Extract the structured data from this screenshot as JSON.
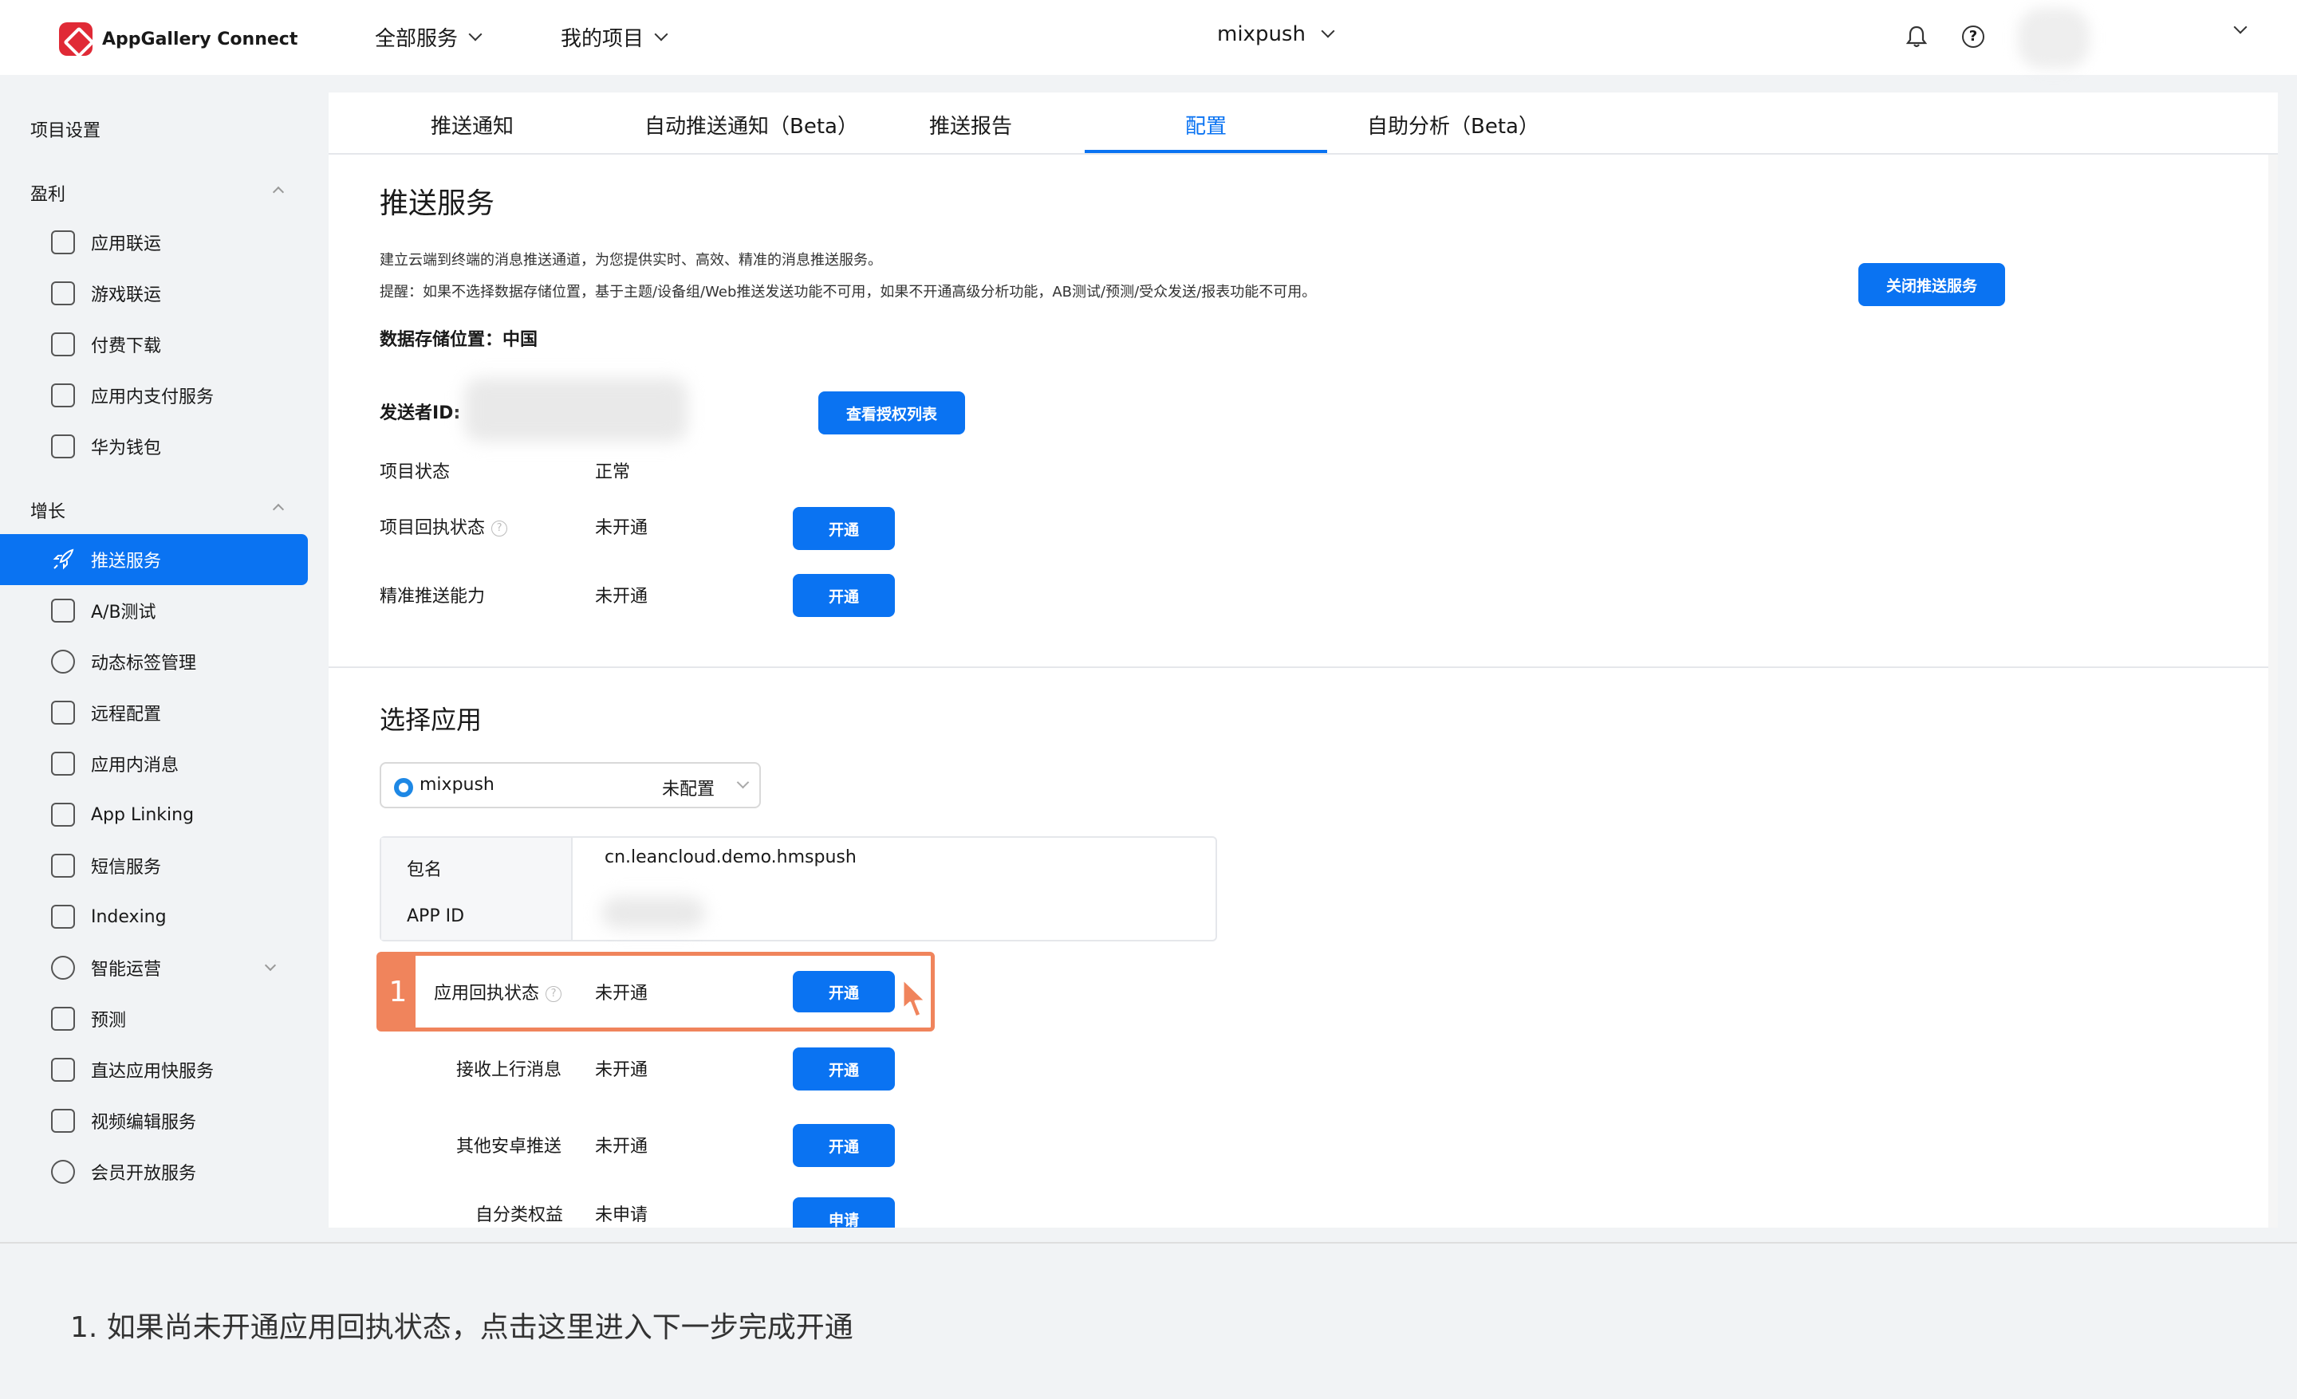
{
  "header": {
    "app_name": "AppGallery Connect",
    "menu_all_services": "全部服务",
    "menu_my_projects": "我的项目",
    "project_selector": "mixpush",
    "help_symbol": "?"
  },
  "sidebar": {
    "project_settings": "项目设置",
    "group_monetize": "盈利",
    "monetize_items": [
      {
        "label": "应用联运",
        "icon": "app-operation-icon"
      },
      {
        "label": "游戏联运",
        "icon": "game-operation-icon"
      },
      {
        "label": "付费下载",
        "icon": "paid-download-icon"
      },
      {
        "label": "应用内支付服务",
        "icon": "in-app-payment-icon"
      },
      {
        "label": "华为钱包",
        "icon": "wallet-icon"
      }
    ],
    "group_growth": "增长",
    "growth_items": [
      {
        "label": "推送服务",
        "icon": "rocket-icon",
        "active": true
      },
      {
        "label": "A/B测试",
        "icon": "ab-test-icon"
      },
      {
        "label": "动态标签管理",
        "icon": "tag-icon"
      },
      {
        "label": "远程配置",
        "icon": "remote-config-icon"
      },
      {
        "label": "应用内消息",
        "icon": "in-app-message-icon"
      },
      {
        "label": "App Linking",
        "icon": "link-icon"
      },
      {
        "label": "短信服务",
        "icon": "sms-icon"
      },
      {
        "label": "Indexing",
        "icon": "indexing-icon"
      },
      {
        "label": "智能运营",
        "icon": "smart-operation-icon"
      },
      {
        "label": "预测",
        "icon": "prediction-icon"
      },
      {
        "label": "直达应用快服务",
        "icon": "quick-service-icon"
      },
      {
        "label": "视频编辑服务",
        "icon": "video-edit-icon"
      },
      {
        "label": "会员开放服务",
        "icon": "member-icon"
      }
    ]
  },
  "tabs": [
    {
      "label": "推送通知"
    },
    {
      "label": "自动推送通知（Beta）"
    },
    {
      "label": "推送报告"
    },
    {
      "label": "配置",
      "active": true
    },
    {
      "label": "自助分析（Beta）"
    }
  ],
  "push_service": {
    "title": "推送服务",
    "desc": "建立云端到终端的消息推送通道，为您提供实时、高效、精准的消息推送服务。",
    "tip": "提醒：如果不选择数据存储位置，基于主题/设备组/Web推送发送功能不可用，如果不开通高级分析功能，AB测试/预测/受众发送/报表功能不可用。",
    "close_button": "关闭推送服务",
    "storage_label": "数据存储位置：中国",
    "sender_label": "发送者ID:",
    "view_auth_button": "查看授权列表",
    "rows": [
      {
        "label": "项目状态",
        "value": "正常"
      },
      {
        "label": "项目回执状态",
        "value": "未开通",
        "button": "开通"
      },
      {
        "label": "精准推送能力",
        "value": "未开通",
        "button": "开通"
      }
    ]
  },
  "select_app": {
    "title": "选择应用",
    "app_name": "mixpush",
    "app_status": "未配置",
    "package_label": "包名",
    "package_value": "cn.leancloud.demo.hmspush",
    "appid_label": "APP ID",
    "rows": [
      {
        "label": "应用回执状态",
        "value": "未开通",
        "button": "开通",
        "highlighted": true
      },
      {
        "label": "接收上行消息",
        "value": "未开通",
        "button": "开通"
      },
      {
        "label": "其他安卓推送",
        "value": "未开通",
        "button": "开通"
      },
      {
        "label": "自分类权益",
        "value": "未申请",
        "button": "申请"
      }
    ]
  },
  "annotation": {
    "step_number": "1",
    "caption": "1. 如果尚未开通应用回执状态，点击这里进入下一步完成开通"
  },
  "colors": {
    "primary": "#0a73f2",
    "highlight": "#f0845c"
  }
}
